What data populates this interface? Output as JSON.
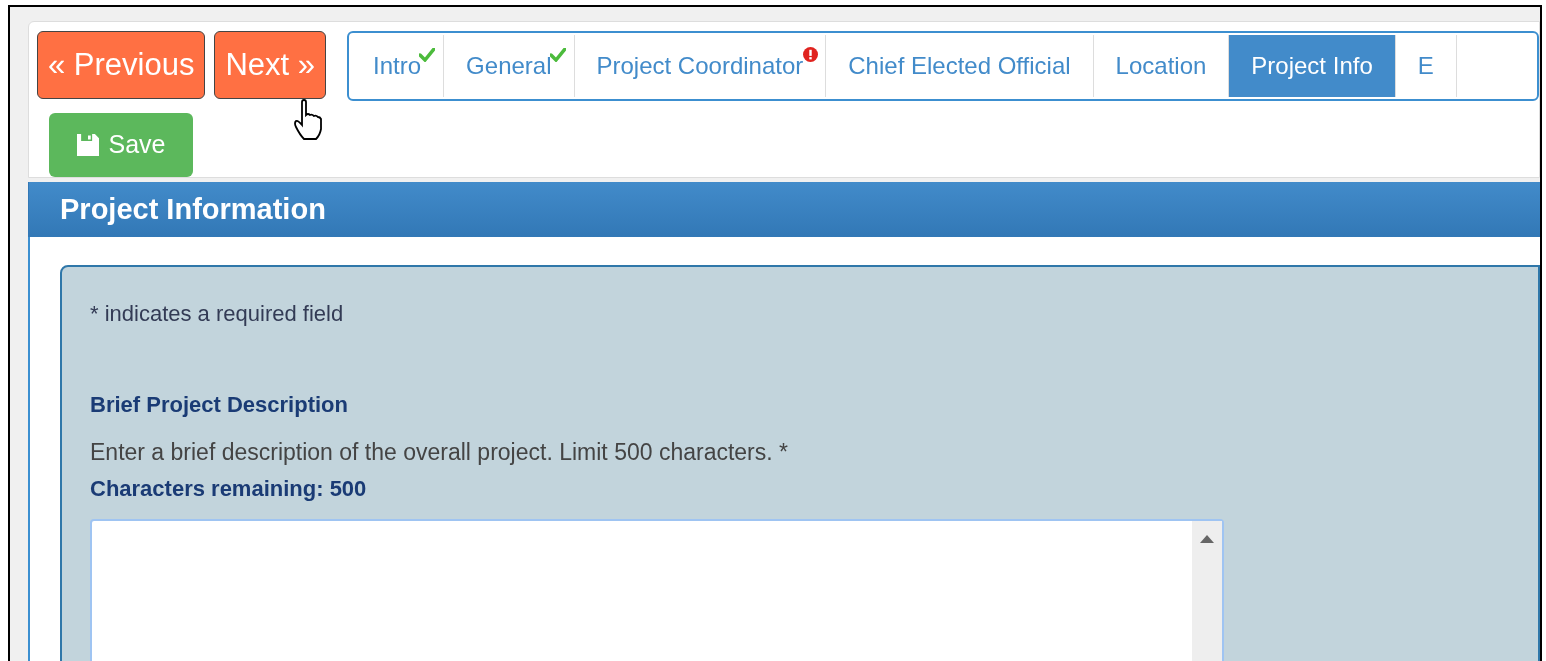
{
  "nav_buttons": [
    {
      "label": "« Previous"
    },
    {
      "label": "Next »"
    }
  ],
  "save_button": {
    "label": "Save"
  },
  "tabs": [
    {
      "label": "Intro",
      "selected": false,
      "kind": "complete"
    },
    {
      "label": "General",
      "selected": false,
      "kind": "complete"
    },
    {
      "label": "Project Coordinator",
      "selected": false,
      "kind": "error"
    },
    {
      "label": "Chief Elected Official",
      "selected": false,
      "kind": "plain"
    },
    {
      "label": "Location",
      "selected": false,
      "kind": "plain"
    },
    {
      "label": "Project Info",
      "selected": true,
      "kind": "plain"
    },
    {
      "label": "E",
      "selected": false,
      "kind": "plain"
    }
  ],
  "panel": {
    "title": "Project Information",
    "required_note": "* indicates a required field",
    "field_label": "Brief Project Description",
    "field_help": "Enter a brief description of the overall project. Limit 500 characters. *",
    "counter": "Characters remaining: 500"
  }
}
